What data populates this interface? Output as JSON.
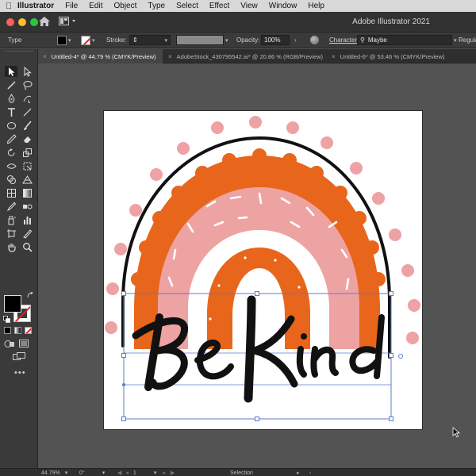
{
  "menubar": {
    "app_name": "Illustrator",
    "items": [
      "File",
      "Edit",
      "Object",
      "Type",
      "Select",
      "Effect",
      "View",
      "Window",
      "Help"
    ]
  },
  "titlebar": {
    "title": "Adobe Illustrator 2021"
  },
  "controlbar": {
    "selection_type": "Type",
    "stroke_label": "Stroke:",
    "opacity_label": "Opacity:",
    "opacity_value": "100%",
    "character_label": "Character:",
    "font_name": "Maybe",
    "font_style": "Regula"
  },
  "tabs": [
    {
      "label": "Untitled-4* @ 44.79 % (CMYK/Preview)",
      "active": true
    },
    {
      "label": "AdobeStock_430795542.ai* @ 20.86 % (RGB/Preview)",
      "active": false
    },
    {
      "label": "Untitled-6* @ 53.46 % (CMYK/Preview)",
      "active": false
    }
  ],
  "statusbar": {
    "zoom": "44.79%",
    "rotation": "0°",
    "artboard_number": "1",
    "tool_name": "Selection"
  },
  "artwork": {
    "text": "Be Kind",
    "colors": {
      "orange": "#e8661b",
      "pink": "#eea3a3",
      "dot_pink": "#eea2a6",
      "outline": "#111111",
      "selection": "#5a7bd1"
    }
  },
  "icons": {
    "home": "home-icon",
    "workspace": "workspace-layout-icon",
    "globe": "recolor-artwork-icon",
    "search": "search-icon",
    "cursor": "mouse-pointer-icon"
  }
}
